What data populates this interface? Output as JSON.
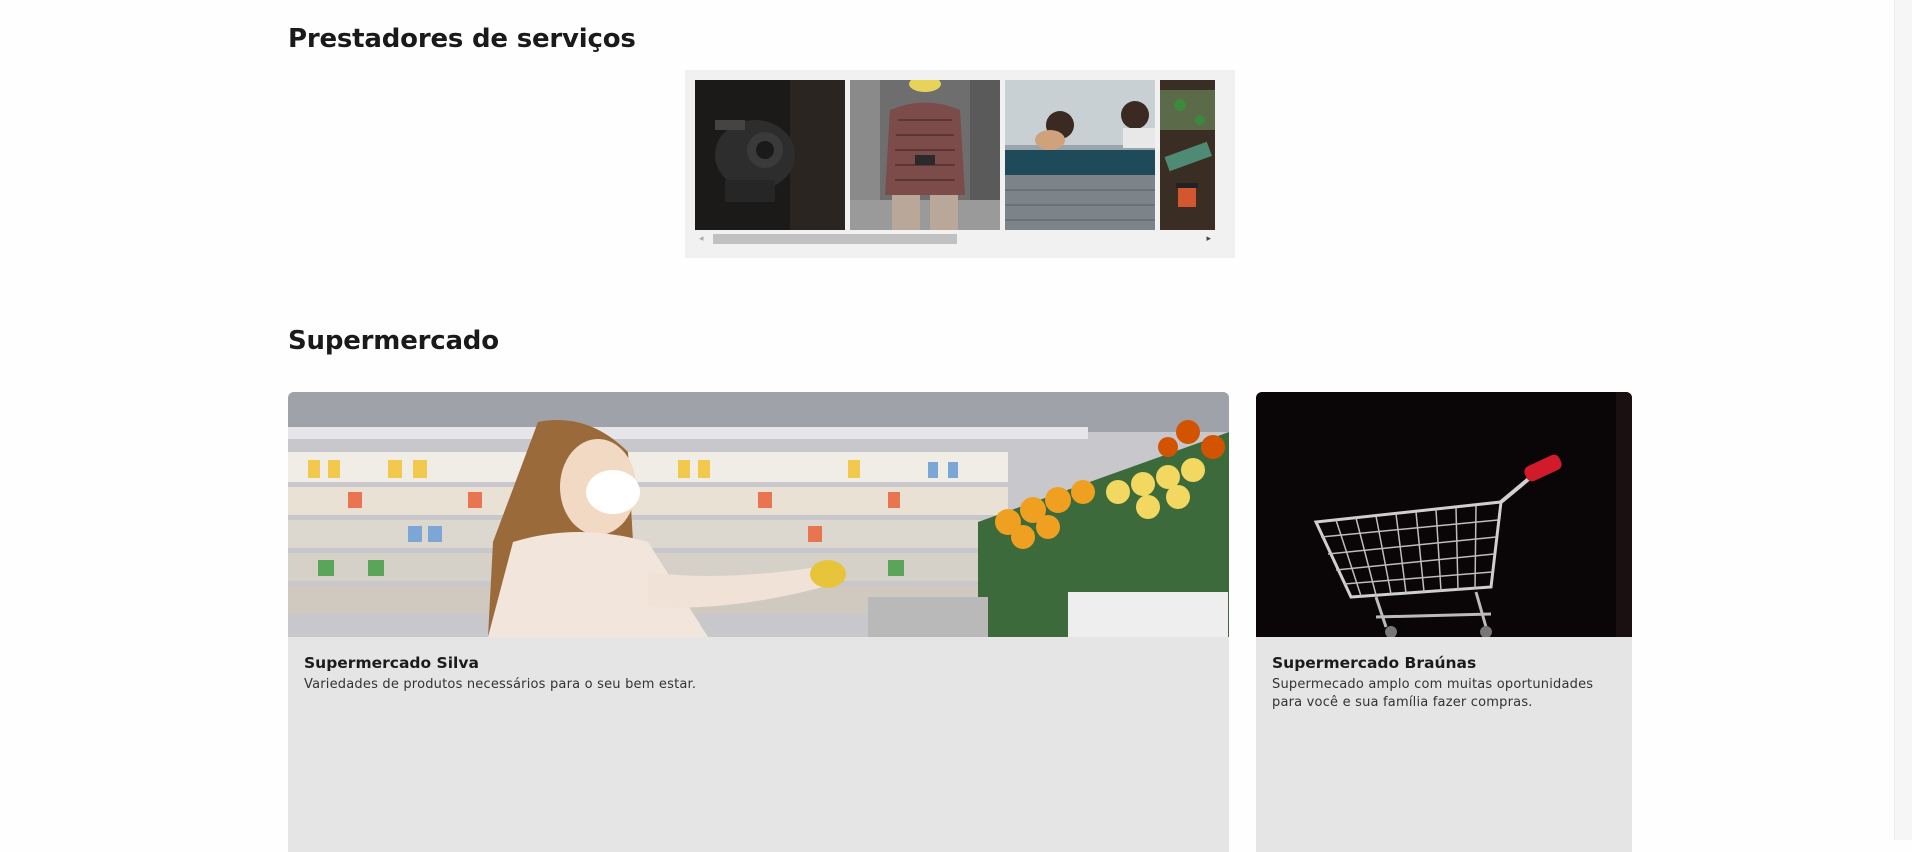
{
  "sections": {
    "providers": {
      "title": "Prestadores de serviços"
    },
    "supermarket": {
      "title": "Supermercado",
      "cards": [
        {
          "title": "Supermercado Silva",
          "description": "Variedades de produtos necessários para o seu bem estar."
        },
        {
          "title": "Supermercado Braúnas",
          "description": "Supermecado amplo com muitas oportunidades para você e sua família fazer compras."
        }
      ]
    }
  },
  "carousel": {
    "scroll_position_fraction": 0.0,
    "visible_fraction": 0.47,
    "left_arrow": "◂",
    "right_arrow": "▸"
  },
  "colors": {
    "card_background": "#e5e5e5",
    "carousel_background": "#f1f1f1",
    "title": "#1a1a1a"
  }
}
